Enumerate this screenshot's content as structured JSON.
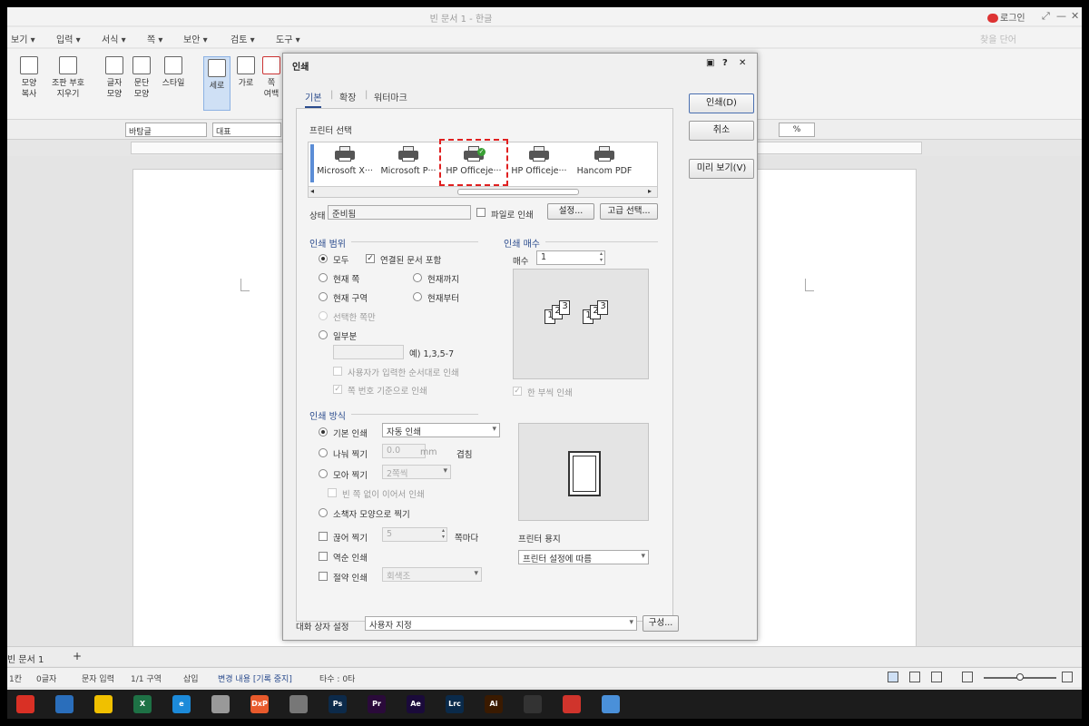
{
  "app": {
    "title": "빈 문서 1 - 한글",
    "login": "로그인",
    "window_controls": [
      "⤢",
      "—",
      "✕"
    ]
  },
  "menu": {
    "items": [
      "보기 ▾",
      "입력 ▾",
      "서식 ▾",
      "쪽 ▾",
      "보안 ▾",
      "검토 ▾",
      "도구 ▾"
    ],
    "right": "찾을 단어"
  },
  "ribbon": {
    "items": [
      {
        "label": "모양\n복사"
      },
      {
        "label": "조판 부호\n지우기"
      },
      {
        "label": "글자\n모양"
      },
      {
        "label": "문단\n모양"
      },
      {
        "label": "스타일"
      },
      {
        "label": "세로"
      },
      {
        "label": "가로"
      },
      {
        "label": "쪽\n여백"
      }
    ]
  },
  "toolbar": {
    "style_box": "바탕글",
    "font_box": "대표",
    "zoom_box": "%"
  },
  "document_tabs": {
    "tab": "빈 문서 1",
    "add": "+"
  },
  "statusbar": {
    "items": [
      "1칸",
      "0글자",
      "문자 입력",
      "1/1 구역",
      "삽입",
      "변경 내용 [기록 중지]",
      "타수 : 0타"
    ]
  },
  "taskbar": {
    "apps": [
      {
        "name": "chrome-icon",
        "label": "",
        "color": "#d93025"
      },
      {
        "name": "hwp-icon",
        "label": "",
        "color": "#2a6ebb"
      },
      {
        "name": "sticky-icon",
        "label": "",
        "color": "#f0c000"
      },
      {
        "name": "excel-icon",
        "label": "X",
        "color": "#1e7145"
      },
      {
        "name": "ie-icon",
        "label": "e",
        "color": "#1c8ad9"
      },
      {
        "name": "paint-icon",
        "label": "",
        "color": "#999999"
      },
      {
        "name": "dxp-icon",
        "label": "DxP",
        "color": "#e85a2c"
      },
      {
        "name": "calculator-icon",
        "label": "",
        "color": "#777777"
      },
      {
        "name": "photoshop-icon",
        "label": "Ps",
        "color": "#0c2a4a"
      },
      {
        "name": "premiere-icon",
        "label": "Pr",
        "color": "#2a0a3a"
      },
      {
        "name": "aftereffects-icon",
        "label": "Ae",
        "color": "#1a0a3a"
      },
      {
        "name": "lightroom-icon",
        "label": "Lrc",
        "color": "#0a2a4a"
      },
      {
        "name": "illustrator-icon",
        "label": "Ai",
        "color": "#3a1a00"
      },
      {
        "name": "obs-icon",
        "label": "",
        "color": "#333333"
      },
      {
        "name": "app-red-icon",
        "label": "",
        "color": "#d0342c"
      },
      {
        "name": "app-blue-icon",
        "label": "",
        "color": "#4a90d9"
      }
    ]
  },
  "dialog": {
    "title": "인쇄",
    "title_icons": [
      "▣",
      "?",
      "✕"
    ],
    "tabs": [
      "기본",
      "확장",
      "워터마크"
    ],
    "buttons": {
      "print": "인쇄(D)",
      "cancel": "취소",
      "preview": "미리 보기(V)"
    },
    "printer_section": "프린터 선택",
    "printers": [
      "Microsoft X···",
      "Microsoft P···",
      "HP Officeje···",
      "HP Officeje···",
      "Hancom PDF"
    ],
    "status_label": "상태",
    "status_value": "준비됨",
    "file_print": "파일로 인쇄",
    "settings_button": "설정...",
    "advanced_button": "고급 선택...",
    "range": {
      "section": "인쇄 범위",
      "all": "모두",
      "include_linked": "연결된 문서 포함",
      "current_page": "현재 쪽",
      "to_current": "현재까지",
      "current_section": "현재 구역",
      "from_current": "현재부터",
      "selection": "선택한 쪽만",
      "partial": "일부분",
      "example": "예) 1,3,5-7",
      "user_order": "사용자가 입력한 순서대로 인쇄",
      "page_number_based": "쪽 번호 기준으로 인쇄"
    },
    "copies": {
      "section": "인쇄 매수",
      "label": "매수",
      "value": "1",
      "collate": "한 부씩 인쇄"
    },
    "method": {
      "section": "인쇄 방식",
      "basic": "기본 인쇄",
      "basic_value": "자동 인쇄",
      "split": "나눠 찍기",
      "split_value": "0.0",
      "split_unit": "mm",
      "overlap": "겹침",
      "collect": "모아 찍기",
      "collect_value": "2쪽씩",
      "no_blank": "빈 쪽 없이 이어서 인쇄",
      "booklet": "소책자 모양으로 찍기",
      "cut": "끊어 찍기",
      "cut_value": "5",
      "cut_unit": "쪽마다",
      "reverse": "역순 인쇄",
      "grayscale": "절약 인쇄",
      "grayscale_value": "회색조"
    },
    "paper": {
      "label": "프린터 용지",
      "value": "프린터 설정에 따름"
    },
    "dialog_settings": {
      "label": "대화 상자 설정",
      "value": "사용자 지정",
      "button": "구성..."
    }
  }
}
